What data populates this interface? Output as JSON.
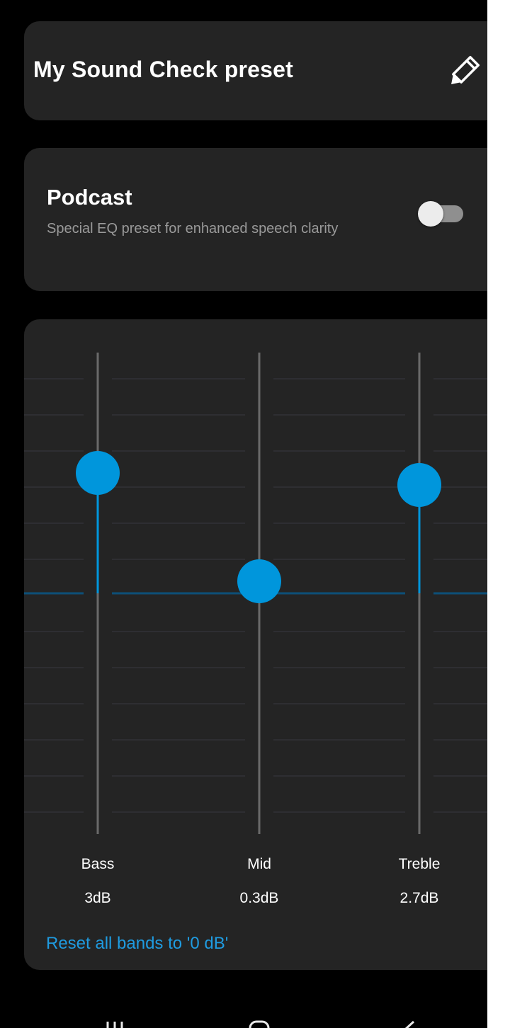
{
  "preset": {
    "title": "My Sound Check preset",
    "edit_icon": "pencil-icon"
  },
  "podcast": {
    "title": "Podcast",
    "description": "Special EQ preset for enhanced speech clarity",
    "toggle_on": false
  },
  "equalizer": {
    "range_db": [
      -6,
      6
    ],
    "bands": [
      {
        "label": "Bass",
        "value_text": "3dB",
        "value_db": 3
      },
      {
        "label": "Mid",
        "value_text": "0.3dB",
        "value_db": 0.3
      },
      {
        "label": "Treble",
        "value_text": "2.7dB",
        "value_db": 2.7
      }
    ],
    "reset_label": "Reset all bands to '0 dB'"
  },
  "colors": {
    "accent": "#0096dc",
    "card_bg": "#242424",
    "screen_bg": "#000000",
    "slider_track": "#6a6a6a",
    "grid_line": "#34343a",
    "zero_line": "#0d4f78"
  },
  "nav": {
    "icons": [
      "recent-apps-icon",
      "home-icon",
      "back-icon"
    ]
  }
}
